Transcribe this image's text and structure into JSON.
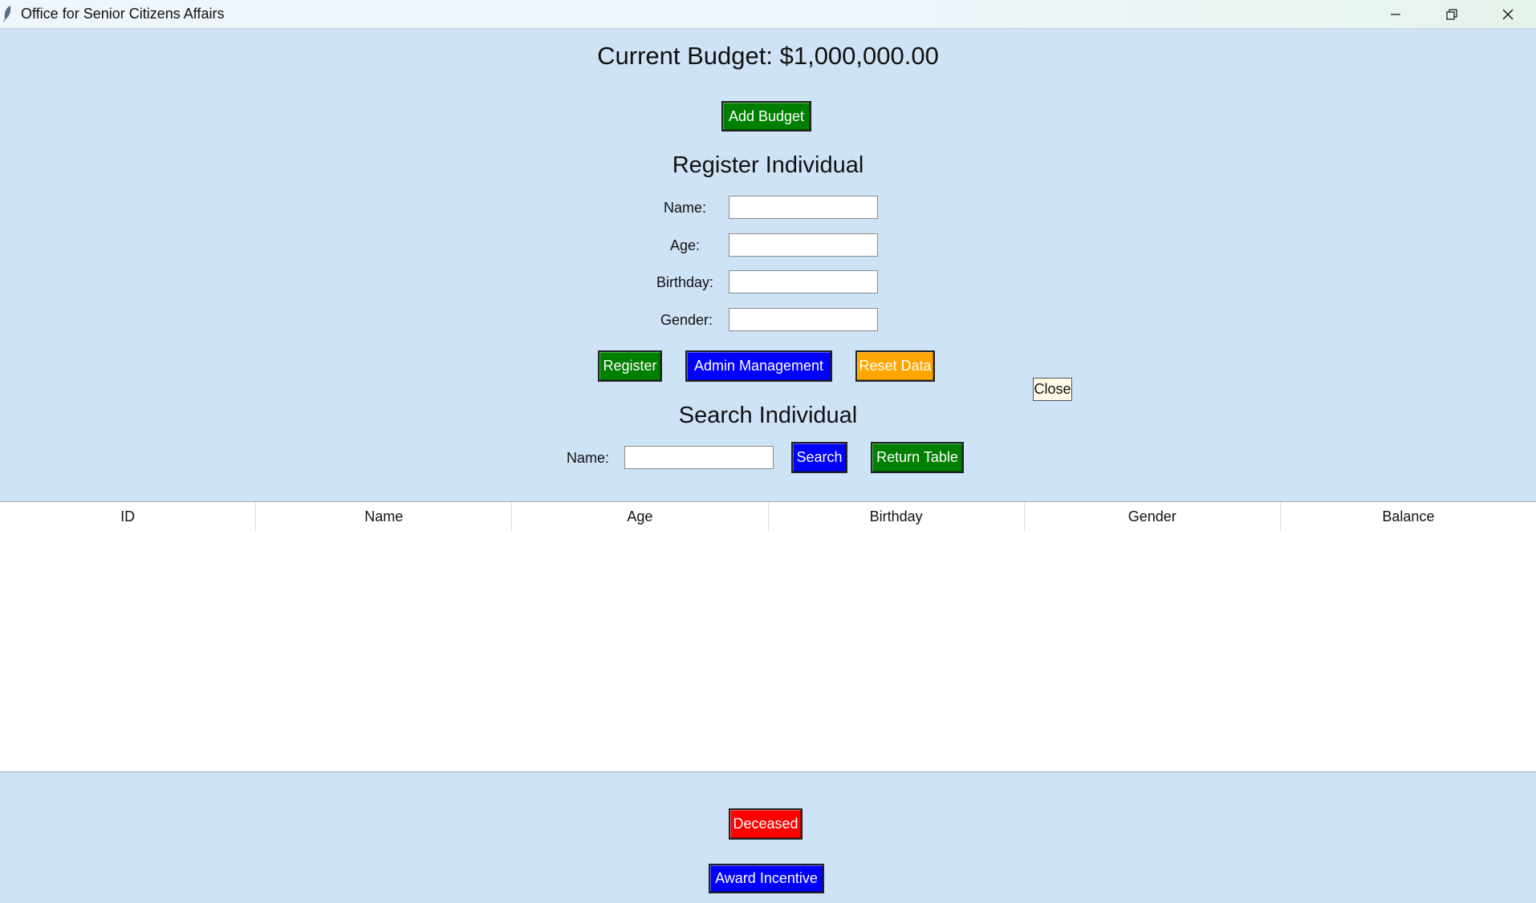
{
  "window": {
    "title": "Office for Senior Citizens Affairs",
    "app_icon": "feather-icon",
    "controls": [
      "minimize-icon",
      "restore-icon",
      "close-icon"
    ]
  },
  "budget": {
    "label": "Current Budget: $1,000,000.00",
    "add_button": "Add Budget"
  },
  "register": {
    "title": "Register Individual",
    "fields": [
      {
        "label": "Name:",
        "value": ""
      },
      {
        "label": "Age:",
        "value": ""
      },
      {
        "label": "Birthday:",
        "value": ""
      },
      {
        "label": "Gender:",
        "value": ""
      }
    ],
    "buttons": {
      "register": "Register",
      "admin": "Admin Management",
      "reset": "Reset Data"
    }
  },
  "close_button": "Close",
  "search": {
    "title": "Search Individual",
    "name_label": "Name:",
    "name_value": "",
    "search_button": "Search",
    "return_button": "Return Table"
  },
  "table": {
    "columns": [
      "ID",
      "Name",
      "Age",
      "Birthday",
      "Gender",
      "Balance"
    ],
    "rows": []
  },
  "actions": {
    "deceased": "Deceased",
    "award": "Award Incentive"
  },
  "colors": {
    "background": "#cfe3f6",
    "green": "#008000",
    "blue": "#0000ff",
    "orange": "#ffa500",
    "red": "#ff0000"
  }
}
